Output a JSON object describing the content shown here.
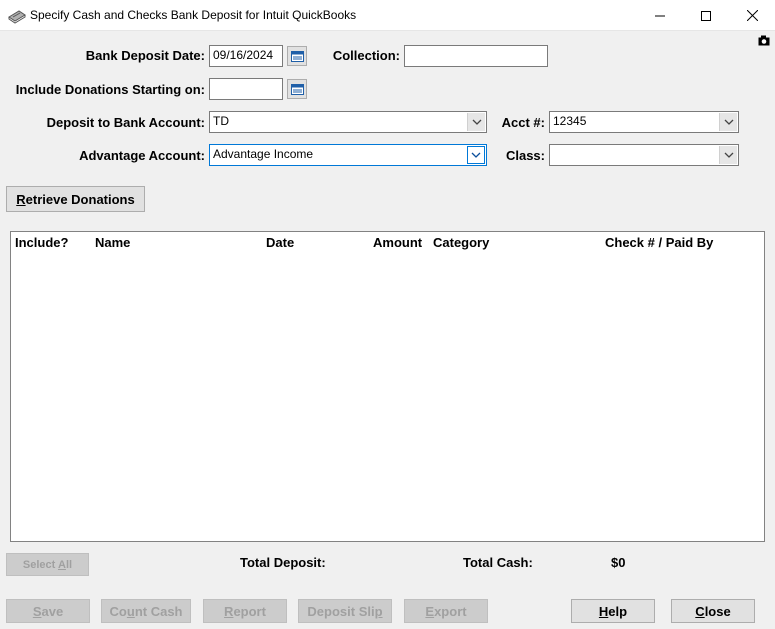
{
  "window": {
    "title": "Specify Cash and Checks Bank Deposit for Intuit QuickBooks"
  },
  "form": {
    "bank_deposit_date_label": "Bank Deposit Date:",
    "bank_deposit_date_value": "09/16/2024",
    "collection_label": "Collection:",
    "collection_value": "",
    "include_donations_label": "Include Donations Starting on:",
    "include_donations_value": "",
    "deposit_account_label": "Deposit to Bank Account:",
    "deposit_account_value": "TD",
    "acct_label": "Acct #:",
    "acct_value": "12345",
    "advantage_label": "Advantage Account:",
    "advantage_value": "Advantage Income",
    "class_label": "Class:",
    "class_value": ""
  },
  "buttons": {
    "retrieve_rest": "etrieve Donations",
    "retrieve_key": "R",
    "select_all_pre": "Select ",
    "select_all_key": "A",
    "select_all_rest": "ll",
    "save_key": "S",
    "save_rest": "ave",
    "count_cash_pre": "Co",
    "count_cash_key": "u",
    "count_cash_rest": "nt Cash",
    "report_key": "R",
    "report_rest": "eport",
    "deposit_slip_pre": "Deposit Sli",
    "deposit_slip_key": "p",
    "export_key": "E",
    "export_rest": "xport",
    "help_key": "H",
    "help_rest": "elp",
    "close_key": "C",
    "close_rest": "lose"
  },
  "table": {
    "columns": [
      "Include?",
      "Name",
      "Date",
      "Amount",
      "Category",
      "Check # / Paid By"
    ],
    "rows": []
  },
  "totals": {
    "total_deposit_label": "Total Deposit:",
    "total_deposit_value": "",
    "total_cash_label": "Total Cash:",
    "total_cash_value": "$0"
  },
  "icons": {
    "app": "deposit-book-icon",
    "calendar": "calendar-icon",
    "dropdown": "chevron-down-icon",
    "camera": "camera-icon"
  },
  "colors": {
    "focus_accent": "#0078d7",
    "window_bg": "#f0f0f0"
  }
}
